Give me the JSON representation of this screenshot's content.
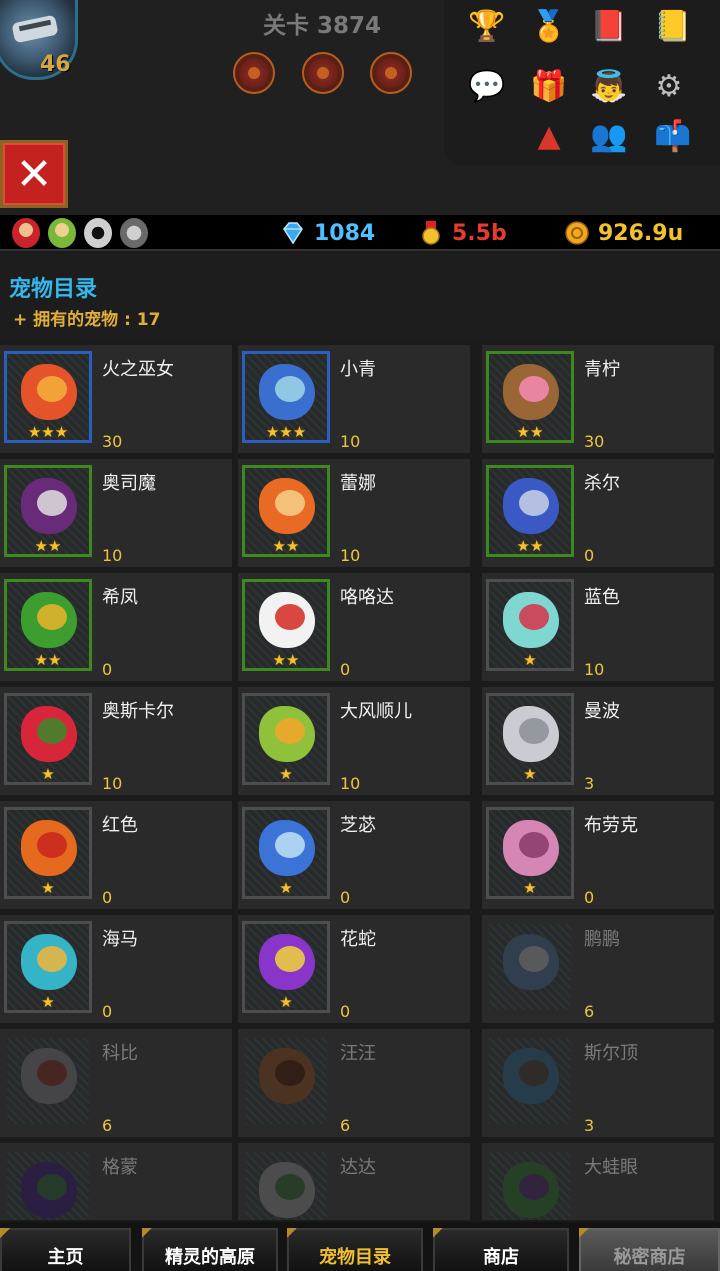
{
  "header": {
    "player_level": "46",
    "stage_label": "关卡 3874"
  },
  "toolbar_icons": [
    {
      "name": "trophy-icon",
      "glyph": "🏆"
    },
    {
      "name": "ranking-podium-icon",
      "glyph": "🏅"
    },
    {
      "name": "hero-book-icon",
      "glyph": "📕"
    },
    {
      "name": "quest-book-icon",
      "glyph": "📒"
    },
    {
      "name": "chat-icon",
      "glyph": "💬"
    },
    {
      "name": "gift-box-icon",
      "glyph": "🎁"
    },
    {
      "name": "angel-icon",
      "glyph": "👼"
    },
    {
      "name": "settings-gear-icon",
      "glyph": "⚙"
    },
    {
      "name": "warning-triangle-icon",
      "glyph": "▲"
    },
    {
      "name": "friends-icon",
      "glyph": "👥"
    },
    {
      "name": "mailbox-icon",
      "glyph": "📫"
    }
  ],
  "resources": {
    "gems": "1084",
    "medals": "5.5b",
    "gold": "926.9u"
  },
  "catalog": {
    "title": "宠物目录",
    "owned_label": "+ 拥有的宠物 : 17"
  },
  "colors": {
    "accent_blue": "#34b8ee",
    "accent_gold": "#e2ad3b",
    "medal_red": "#e83a2e",
    "frame_blue": "#2a5fc0",
    "frame_green": "#3c8a1e"
  },
  "pets": [
    {
      "name": "火之巫女",
      "count": "30",
      "stars": "★★★",
      "frame": "blue",
      "color": "#e5532a",
      "color2": "#f4b23a",
      "locked": false
    },
    {
      "name": "小青",
      "count": "10",
      "stars": "★★★",
      "frame": "blue",
      "color": "#3a6fd0",
      "color2": "#9fd7e8",
      "locked": false
    },
    {
      "name": "青柠",
      "count": "30",
      "stars": "★★",
      "frame": "green",
      "color": "#9a6636",
      "color2": "#f48bb5",
      "locked": false
    },
    {
      "name": "奥司魔",
      "count": "10",
      "stars": "★★",
      "frame": "green",
      "color": "#6a2a7a",
      "color2": "#e0e0e0",
      "locked": false
    },
    {
      "name": "蕾娜",
      "count": "10",
      "stars": "★★",
      "frame": "green",
      "color": "#e86a24",
      "color2": "#f5d08a",
      "locked": false
    },
    {
      "name": "杀尔",
      "count": "0",
      "stars": "★★",
      "frame": "green",
      "color": "#3b59c4",
      "color2": "#c9d2e6",
      "locked": false
    },
    {
      "name": "希凤",
      "count": "0",
      "stars": "★★",
      "frame": "green",
      "color": "#3c9e2e",
      "color2": "#e9b42b",
      "locked": false
    },
    {
      "name": "咯咯达",
      "count": "0",
      "stars": "★★",
      "frame": "green",
      "color": "#f2f2f2",
      "color2": "#d42a22",
      "locked": false
    },
    {
      "name": "蓝色",
      "count": "10",
      "stars": "★",
      "frame": "gray",
      "color": "#7ed8d1",
      "color2": "#d8324a",
      "locked": false
    },
    {
      "name": "奥斯卡尔",
      "count": "10",
      "stars": "★",
      "frame": "gray",
      "color": "#d7263a",
      "color2": "#3a8a2a",
      "locked": false
    },
    {
      "name": "大风顺儿",
      "count": "10",
      "stars": "★",
      "frame": "gray",
      "color": "#8fc23a",
      "color2": "#f4a42a",
      "locked": false
    },
    {
      "name": "曼波",
      "count": "3",
      "stars": "★",
      "frame": "gray",
      "color": "#c9ccd2",
      "color2": "#8b8f98",
      "locked": false
    },
    {
      "name": "红色",
      "count": "0",
      "stars": "★",
      "frame": "gray",
      "color": "#e56a1e",
      "color2": "#c8241e",
      "locked": false
    },
    {
      "name": "芝苾",
      "count": "0",
      "stars": "★",
      "frame": "gray",
      "color": "#3b73d6",
      "color2": "#bfe3f4",
      "locked": false
    },
    {
      "name": "布劳克",
      "count": "0",
      "stars": "★",
      "frame": "gray",
      "color": "#d686b4",
      "color2": "#8a3a6a",
      "locked": false
    },
    {
      "name": "海马",
      "count": "0",
      "stars": "★",
      "frame": "gray",
      "color": "#35b3c7",
      "color2": "#f1b53a",
      "locked": false
    },
    {
      "name": "花蛇",
      "count": "0",
      "stars": "★",
      "frame": "gray",
      "color": "#8a35c9",
      "color2": "#f2d33a",
      "locked": false
    },
    {
      "name": "鹏鹏",
      "count": "6",
      "stars": "",
      "frame": "none",
      "color": "#5b8cc8",
      "color2": "#d0d0d0",
      "locked": true
    },
    {
      "name": "科比",
      "count": "6",
      "stars": "",
      "frame": "none",
      "color": "#9a9aa2",
      "color2": "#d03a2a",
      "locked": true
    },
    {
      "name": "汪汪",
      "count": "6",
      "stars": "",
      "frame": "none",
      "color": "#c46a2a",
      "color2": "#7a3a1a",
      "locked": true
    },
    {
      "name": "斯尔顶",
      "count": "3",
      "stars": "",
      "frame": "none",
      "color": "#3a8ac4",
      "color2": "#7a5a3a",
      "locked": true
    },
    {
      "name": "格蒙",
      "count": "",
      "stars": "",
      "frame": "none",
      "color": "#6a3ac4",
      "color2": "#3a9a3a",
      "locked": true
    },
    {
      "name": "达达",
      "count": "",
      "stars": "",
      "frame": "none",
      "color": "#a8a8a8",
      "color2": "#3a8a3a",
      "locked": true
    },
    {
      "name": "大蛙眼",
      "count": "",
      "stars": "",
      "frame": "none",
      "color": "#3a9a3a",
      "color2": "#8a3ac4",
      "locked": true
    }
  ],
  "nav": {
    "tabs": [
      {
        "label": "主页",
        "state": "normal"
      },
      {
        "label": "精灵的高原",
        "state": "normal"
      },
      {
        "label": "宠物目录",
        "state": "active"
      },
      {
        "label": "商店",
        "state": "normal"
      },
      {
        "label": "秘密商店",
        "state": "disabled"
      }
    ]
  }
}
